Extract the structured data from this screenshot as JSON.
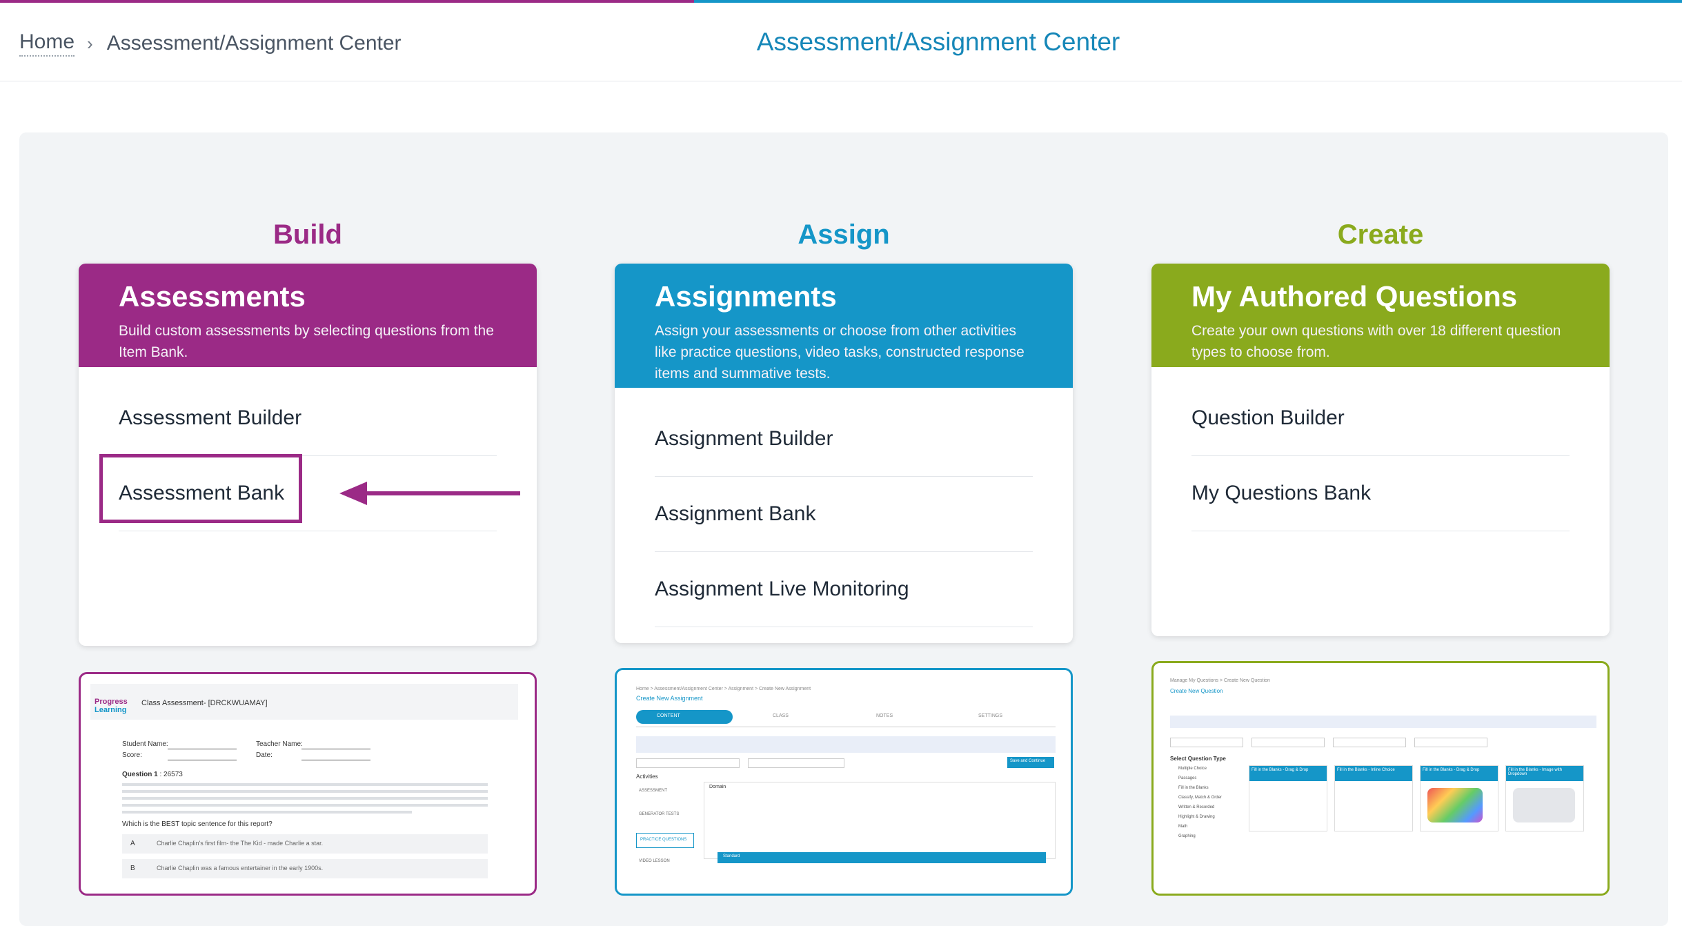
{
  "breadcrumb": {
    "home": "Home",
    "current": "Assessment/Assignment Center"
  },
  "page_title": "Assessment/Assignment Center",
  "colors": {
    "build": "#9b2a86",
    "assign": "#1596c8",
    "create": "#8aaa1d"
  },
  "columns": {
    "build": {
      "title": "Build",
      "card_title": "Assessments",
      "card_desc": "Build custom assessments by selecting questions from the Item Bank.",
      "items": [
        "Assessment Builder",
        "Assessment Bank"
      ]
    },
    "assign": {
      "title": "Assign",
      "card_title": "Assignments",
      "card_desc": "Assign your assessments or choose from other activities like practice questions, video tasks, constructed response items and summative tests.",
      "items": [
        "Assignment Builder",
        "Assignment Bank",
        "Assignment Live Monitoring"
      ]
    },
    "create": {
      "title": "Create",
      "card_title": "My Authored Questions",
      "card_desc": "Create your own questions with over 18 different question types to choose from.",
      "items": [
        "Question Builder",
        "My Questions Bank"
      ]
    }
  },
  "thumbnails": {
    "build": {
      "logo_top": "Progress",
      "logo_bottom": "Learning",
      "title": "Class Assessment- [DRCKWUAMAY]",
      "student_name": "Student Name:",
      "teacher_name": "Teacher Name:",
      "score": "Score:",
      "date": "Date:",
      "question": "Question 1",
      "question_id": " : 26573",
      "prompt": "Which is the BEST topic sentence for this report?",
      "option_a_letter": "A",
      "option_a": "Charlie Chaplin's first film- the The Kid - made Charlie a star.",
      "option_b_letter": "B",
      "option_b": "Charlie Chaplin was a famous entertainer in the early 1900s."
    },
    "assign": {
      "crumbs": "Home  >  Assessment/Assignment Center  >  Assignment  >  Create New Assignment",
      "title": "Create New Assignment",
      "steps": [
        "CONTENT",
        "CLASS",
        "NOTES",
        "SETTINGS"
      ],
      "save_label": "Save and Continue",
      "activities": "Activities",
      "activity_items": [
        "ASSESSMENT",
        "GENERATOR TESTS",
        "PRACTICE QUESTIONS",
        "VIDEO LESSON"
      ],
      "domain": "Domain",
      "standard": "Standard"
    },
    "create": {
      "crumbs": "Manage My Questions  >  Create New Question",
      "title": "Create New Question",
      "select_type": "Select Question Type",
      "types": [
        "Multiple Choice",
        "Passages",
        "Fill in the Blanks",
        "Classify, Match & Order",
        "Written & Recorded",
        "Highlight & Drawing",
        "Math",
        "Graphing"
      ],
      "tiles": [
        "Fill in the Blanks - Drag & Drop",
        "Fill in the Blanks - Inline Choice",
        "Fill in the Blanks - Drag & Drop",
        "Fill in the Blanks - Image with Dropdown"
      ]
    }
  }
}
